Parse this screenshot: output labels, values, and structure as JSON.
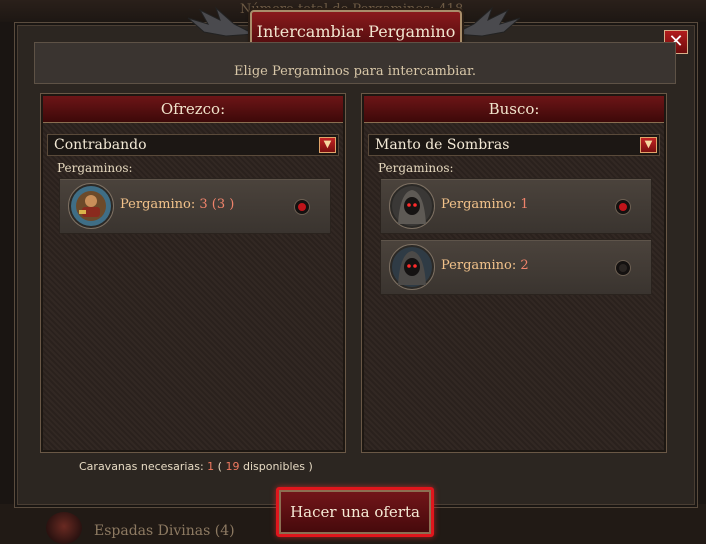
{
  "background": {
    "top_text": "Número total de Pergaminos: 418",
    "bottom_text": "Espadas Divinas  (4)"
  },
  "window": {
    "title": "Intercambiar Pergamino",
    "close_label": "✕",
    "subtitle": "Elige Pergaminos para intercambiar."
  },
  "offer_panel": {
    "header": "Ofrezco:",
    "dropdown_value": "Contrabando",
    "dropdown_arrow": "▼",
    "items_label": "Pergaminos:",
    "items": [
      {
        "label": "Pergamino:",
        "count": "3",
        "paren": "(3 )",
        "selected": true,
        "icon": "smuggler-portrait-icon"
      }
    ]
  },
  "seek_panel": {
    "header": "Busco:",
    "dropdown_value": "Manto de Sombras",
    "dropdown_arrow": "▼",
    "items_label": "Pergaminos:",
    "items": [
      {
        "label": "Pergamino:",
        "count": "1",
        "selected": true,
        "icon": "hooded-figure-icon"
      },
      {
        "label": "Pergamino:",
        "count": "2",
        "selected": false,
        "icon": "hooded-figure-icon"
      }
    ]
  },
  "caravans": {
    "prefix": "Caravanas necesarias:",
    "required": "1",
    "open_paren": " (",
    "available": "19",
    "suffix": " disponibles  )"
  },
  "offer_button": "Hacer una oferta",
  "colors": {
    "accent_red": "#e0161c",
    "item_label": "#f2c28a",
    "number": "#f0836b",
    "selected_dot": "#c0141a"
  }
}
